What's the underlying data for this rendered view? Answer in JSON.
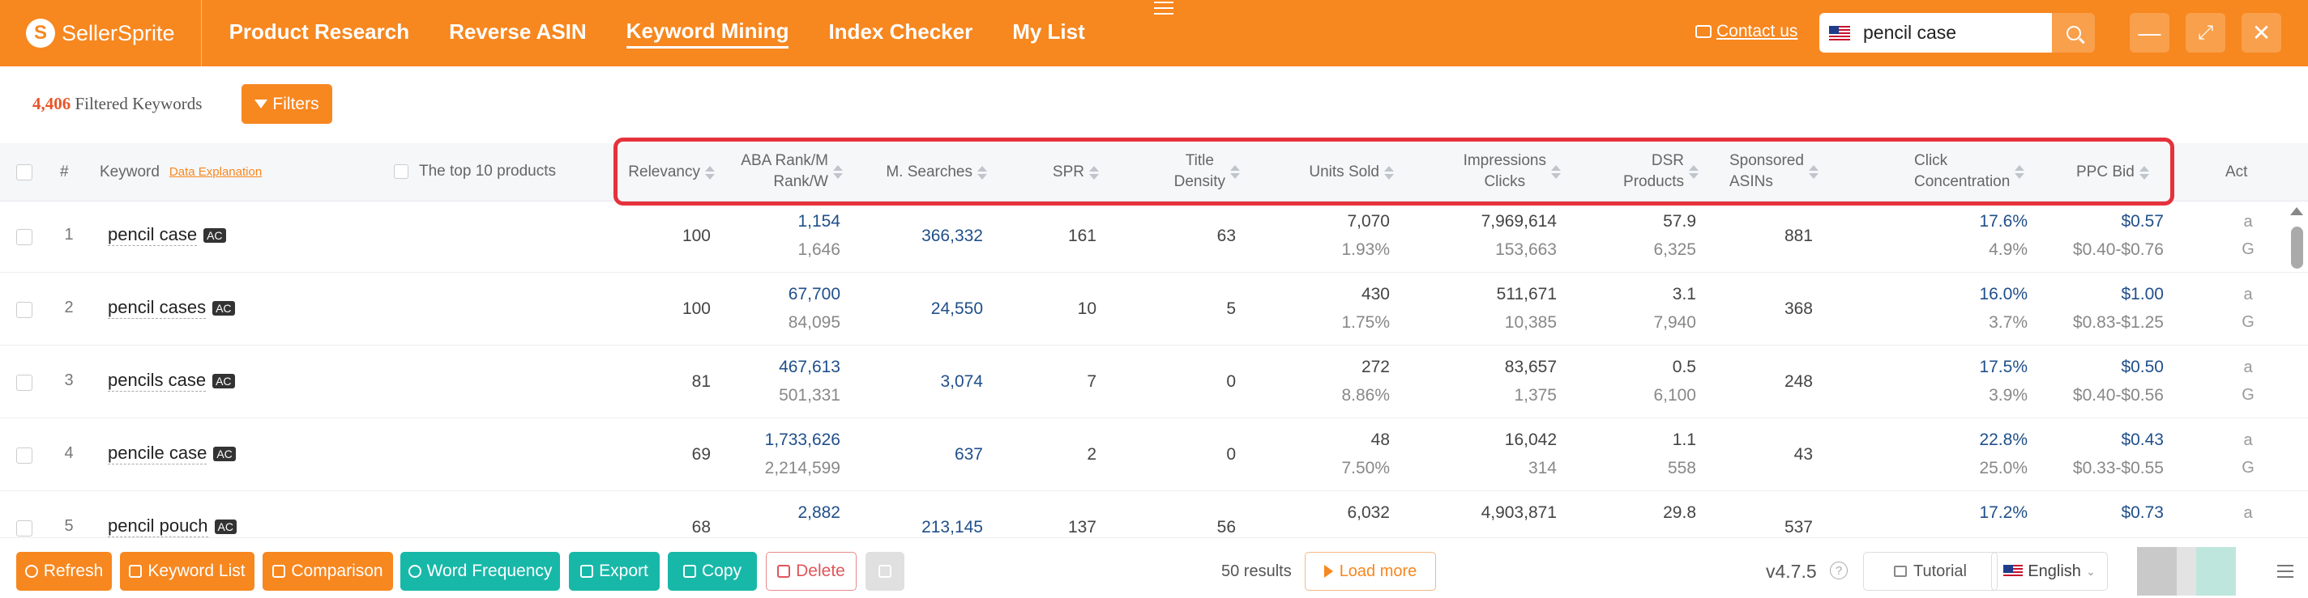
{
  "brand": {
    "name": "SellerSprite"
  },
  "nav": [
    {
      "label": "Product Research"
    },
    {
      "label": "Reverse ASIN"
    },
    {
      "label": "Keyword Mining"
    },
    {
      "label": "Index Checker"
    },
    {
      "label": "My List"
    }
  ],
  "header": {
    "contact_label": "Contact us",
    "search_value": "pencil case",
    "colors": {
      "topbar": "#f7871f",
      "accent": "#f7871f",
      "highlight_border": "#e5323c"
    }
  },
  "summary": {
    "count": "4,406",
    "label": "Filtered Keywords",
    "filters_label": "Filters"
  },
  "table": {
    "headers": {
      "index": "#",
      "keyword": "Keyword",
      "data_explanation": "Data Explanation",
      "top10": "The top 10 products",
      "relevancy": "Relevancy",
      "aba_rank_1": "ABA Rank/M",
      "aba_rank_2": "Rank/W",
      "m_searches": "M. Searches",
      "spr": "SPR",
      "title_density_1": "Title",
      "title_density_2": "Density",
      "units_sold": "Units Sold",
      "impressions_1": "Impressions",
      "impressions_2": "Clicks",
      "dsr_1": "DSR",
      "dsr_2": "Products",
      "sponsored_1": "Sponsored",
      "sponsored_2": "ASINs",
      "click_conc_1": "Click",
      "click_conc_2": "Concentration",
      "ppc_bid": "PPC Bid",
      "act": "Act"
    },
    "rows": [
      {
        "n": "1",
        "keyword": "pencil case",
        "badge": "AC",
        "relevancy": "100",
        "aba_m": "1,154",
        "aba_w": "1,646",
        "searches": "366,332",
        "spr": "161",
        "title_density": "63",
        "units": "7,070",
        "units_pct": "1.93%",
        "impressions": "7,969,614",
        "clicks": "153,663",
        "dsr": "57.9",
        "products": "6,325",
        "sponsored": "881",
        "click_conc": "17.6%",
        "click_conc_2": "4.9%",
        "ppc": "$0.57",
        "ppc_range": "$0.40-$0.76",
        "act_1": "a",
        "act_2": "G"
      },
      {
        "n": "2",
        "keyword": "pencil cases",
        "badge": "AC",
        "relevancy": "100",
        "aba_m": "67,700",
        "aba_w": "84,095",
        "searches": "24,550",
        "spr": "10",
        "title_density": "5",
        "units": "430",
        "units_pct": "1.75%",
        "impressions": "511,671",
        "clicks": "10,385",
        "dsr": "3.1",
        "products": "7,940",
        "sponsored": "368",
        "click_conc": "16.0%",
        "click_conc_2": "3.7%",
        "ppc": "$1.00",
        "ppc_range": "$0.83-$1.25",
        "act_1": "a",
        "act_2": "G"
      },
      {
        "n": "3",
        "keyword": "pencils case",
        "badge": "AC",
        "relevancy": "81",
        "aba_m": "467,613",
        "aba_w": "501,331",
        "searches": "3,074",
        "spr": "7",
        "title_density": "0",
        "units": "272",
        "units_pct": "8.86%",
        "impressions": "83,657",
        "clicks": "1,375",
        "dsr": "0.5",
        "products": "6,100",
        "sponsored": "248",
        "click_conc": "17.5%",
        "click_conc_2": "3.9%",
        "ppc": "$0.50",
        "ppc_range": "$0.40-$0.56",
        "act_1": "a",
        "act_2": "G"
      },
      {
        "n": "4",
        "keyword": "pencile case",
        "badge": "AC",
        "relevancy": "69",
        "aba_m": "1,733,626",
        "aba_w": "2,214,599",
        "searches": "637",
        "spr": "2",
        "title_density": "0",
        "units": "48",
        "units_pct": "7.50%",
        "impressions": "16,042",
        "clicks": "314",
        "dsr": "1.1",
        "products": "558",
        "sponsored": "43",
        "click_conc": "22.8%",
        "click_conc_2": "25.0%",
        "ppc": "$0.43",
        "ppc_range": "$0.33-$0.55",
        "act_1": "a",
        "act_2": "G"
      },
      {
        "n": "5",
        "keyword": "pencil pouch",
        "badge": "AC",
        "relevancy": "68",
        "aba_m": "2,882",
        "aba_w": "",
        "searches": "213,145",
        "spr": "137",
        "title_density": "56",
        "units": "6,032",
        "units_pct": "",
        "impressions": "4,903,871",
        "clicks": "",
        "dsr": "29.8",
        "products": "",
        "sponsored": "537",
        "click_conc": "17.2%",
        "click_conc_2": "",
        "ppc": "$0.73",
        "ppc_range": "",
        "act_1": "a",
        "act_2": ""
      }
    ]
  },
  "footer": {
    "refresh": "Refresh",
    "keyword_list": "Keyword List",
    "comparison": "Comparison",
    "word_frequency": "Word Frequency",
    "export": "Export",
    "copy": "Copy",
    "delete": "Delete",
    "results": "50 results",
    "load_more": "Load more",
    "version": "v4.7.5",
    "help": "?",
    "tutorial": "Tutorial",
    "language": "English"
  }
}
